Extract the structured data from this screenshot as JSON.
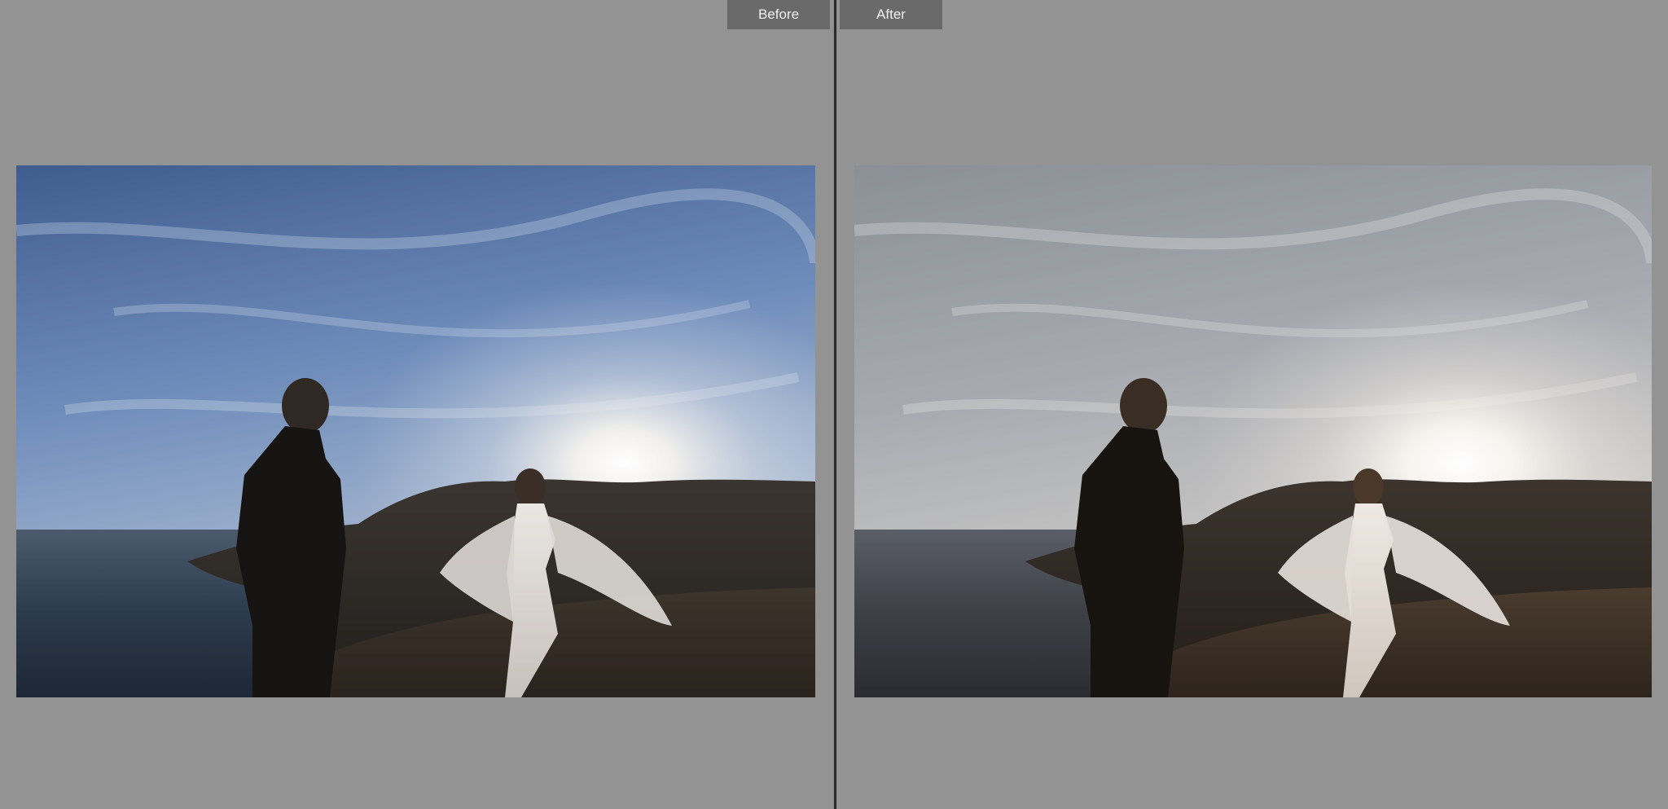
{
  "compare": {
    "before_label": "Before",
    "after_label": "After"
  },
  "photos": {
    "before": {
      "subject": "wedding-couple-sunset"
    },
    "after": {
      "subject": "wedding-couple-sunset"
    }
  },
  "colors": {
    "workspace_bg": "#939393",
    "tab_bg": "#6a6a6a",
    "tab_text": "#f0f0f0",
    "divider": "#2b2b2b"
  }
}
